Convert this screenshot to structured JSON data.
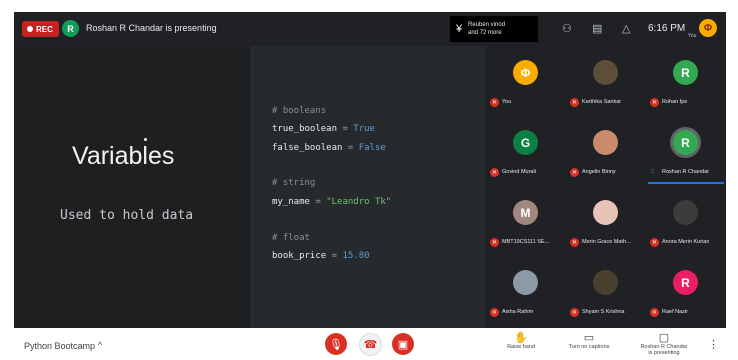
{
  "topbar": {
    "rec_label": "REC",
    "presenter_initial": "R",
    "presenter_text": "Roshan R Chandar is presenting",
    "viewers_line1": "Reuben vinod",
    "viewers_line2": "and 72 more",
    "time": "6:16 PM",
    "you_label": "You"
  },
  "slide": {
    "title": "Variables",
    "subtitle": "Used to hold data",
    "code": {
      "c1": "# booleans",
      "l1_name": "true_boolean",
      "l1_op": " = ",
      "l1_val": "True",
      "l2_name": "false_boolean",
      "l2_op": " = ",
      "l2_val": "False",
      "c2": "# string",
      "l3_name": "my_name",
      "l3_op": " = ",
      "l3_val": "\"Leandro Tk\"",
      "c3": "# float",
      "l4_name": "book_price",
      "l4_op": " = ",
      "l4_val": "15.80"
    }
  },
  "participants": [
    {
      "name": "You",
      "initial": "Φ",
      "color": "#f9ab00"
    },
    {
      "name": "Karthika Sankar",
      "initial": "",
      "color": "#5d4e3a"
    },
    {
      "name": "Rohan Ipe",
      "initial": "R",
      "color": "#34a853"
    },
    {
      "name": "Govind Murali",
      "initial": "G",
      "color": "#0b8043"
    },
    {
      "name": "Angelin Binny",
      "initial": "",
      "color": "#c98b6b"
    },
    {
      "name": "Roshan R Chandar",
      "initial": "R",
      "color": "#34a853"
    },
    {
      "name": "MBT19CS111 SE...",
      "initial": "M",
      "color": "#a1887f"
    },
    {
      "name": "Merin Grace Math...",
      "initial": "",
      "color": "#e8c4b8"
    },
    {
      "name": "Anora Merin Kurian",
      "initial": "",
      "color": "#3c3c3c"
    },
    {
      "name": "Aisha Rahim",
      "initial": "",
      "color": "#8d9aa6"
    },
    {
      "name": "Shyam S Krishna",
      "initial": "",
      "color": "#4a4030"
    },
    {
      "name": "Raef Nazir",
      "initial": "R",
      "color": "#e91e63"
    }
  ],
  "bottombar": {
    "meeting_name": "Python Bootcamp",
    "raise_hand": "Raise hand",
    "captions": "Turn on captions",
    "presenting_line1": "Roshan R Chandar",
    "presenting_line2": "is presenting"
  }
}
